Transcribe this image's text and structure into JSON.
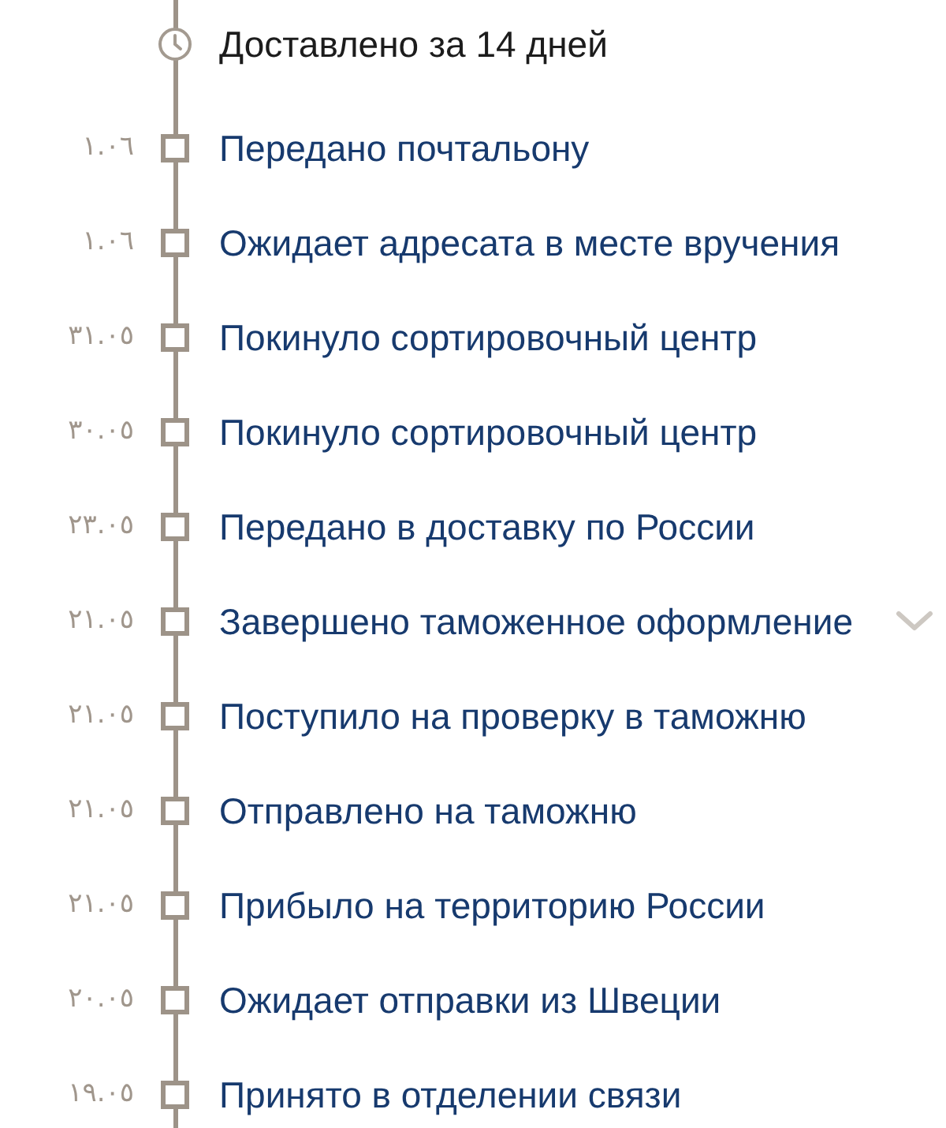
{
  "summary": {
    "text": "Доставлено за 14 дней"
  },
  "events": [
    {
      "date": "١.٠٦",
      "label": "Передано почтальону",
      "expandable": false
    },
    {
      "date": "١.٠٦",
      "label": "Ожидает адресата в месте вручения",
      "expandable": false
    },
    {
      "date": "٣١.٠٥",
      "label": "Покинуло сортировочный центр",
      "expandable": false
    },
    {
      "date": "٣٠.٠٥",
      "label": "Покинуло сортировочный центр",
      "expandable": false
    },
    {
      "date": "٢٣.٠٥",
      "label": "Передано в доставку по России",
      "expandable": false
    },
    {
      "date": "٢١.٠٥",
      "label": "Завершено таможенное оформление",
      "expandable": true
    },
    {
      "date": "٢١.٠٥",
      "label": "Поступило на проверку в таможню",
      "expandable": false
    },
    {
      "date": "٢١.٠٥",
      "label": "Отправлено на таможню",
      "expandable": false
    },
    {
      "date": "٢١.٠٥",
      "label": "Прибыло на территорию России",
      "expandable": false
    },
    {
      "date": "٢٠.٠٥",
      "label": "Ожидает отправки из Швеции",
      "expandable": false
    },
    {
      "date": "١٩.٠٥",
      "label": "Принято в отделении связи",
      "expandable": false
    }
  ]
}
